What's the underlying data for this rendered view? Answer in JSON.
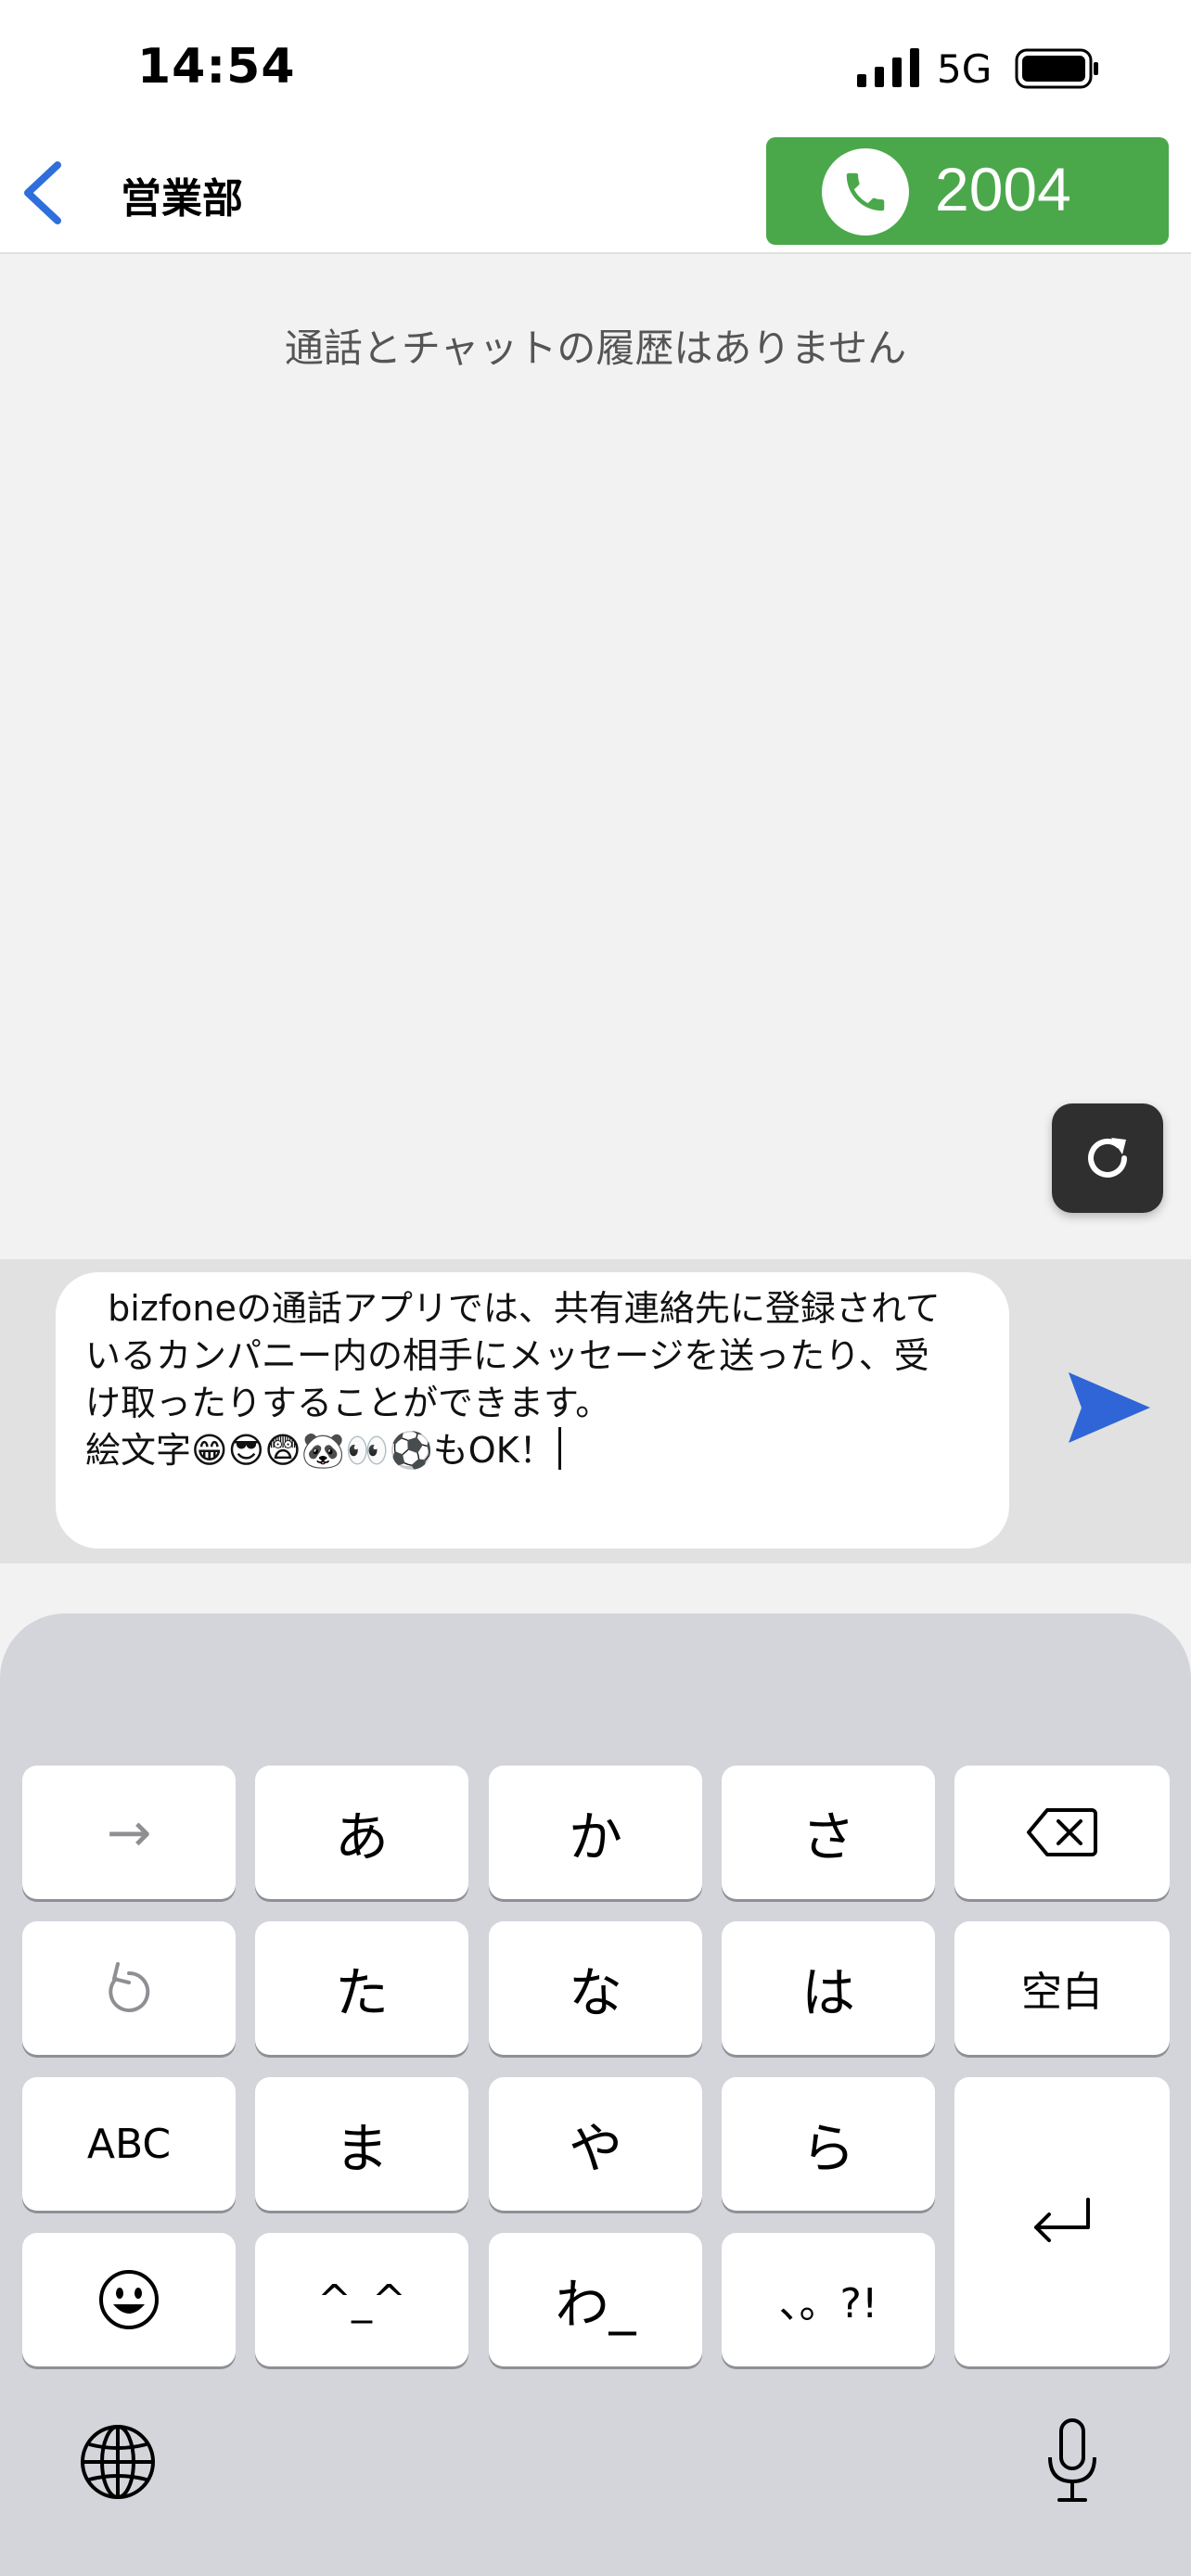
{
  "status_bar": {
    "time": "14:54",
    "network": "5G"
  },
  "nav": {
    "title": "営業部",
    "call_number": "2004"
  },
  "history": {
    "empty_message": "通話とチャットの履歴はありません"
  },
  "compose": {
    "lines": [
      "  bizfoneの通話アプリでは、共有連絡先に登録されて",
      "いるカンパニー内の相手にメッセージを送ったり、受",
      "け取ったりすることができます。",
      "絵文字😁😎😨🐼👀⚽もOK！"
    ]
  },
  "keyboard": {
    "rows": [
      [
        "→",
        "あ",
        "か",
        "さ",
        "delete"
      ],
      [
        "undo",
        "た",
        "な",
        "は",
        "空白"
      ],
      [
        "ABC",
        "ま",
        "や",
        "ら",
        "return"
      ],
      [
        "emoji",
        "^_^",
        "わ_",
        "、。?!"
      ]
    ],
    "labels": {
      "arrow": "→",
      "a": "あ",
      "ka": "か",
      "sa": "さ",
      "ta": "た",
      "na": "な",
      "ha": "は",
      "space": "空白",
      "abc": "ABC",
      "ma": "ま",
      "ya": "や",
      "ra": "ら",
      "kaomoji": "^_^",
      "wa": "わ_",
      "punct": "、。?!"
    }
  },
  "colors": {
    "accent_blue": "#2e6fdc",
    "call_green": "#4aa84a",
    "send_blue": "#2f65d6"
  }
}
